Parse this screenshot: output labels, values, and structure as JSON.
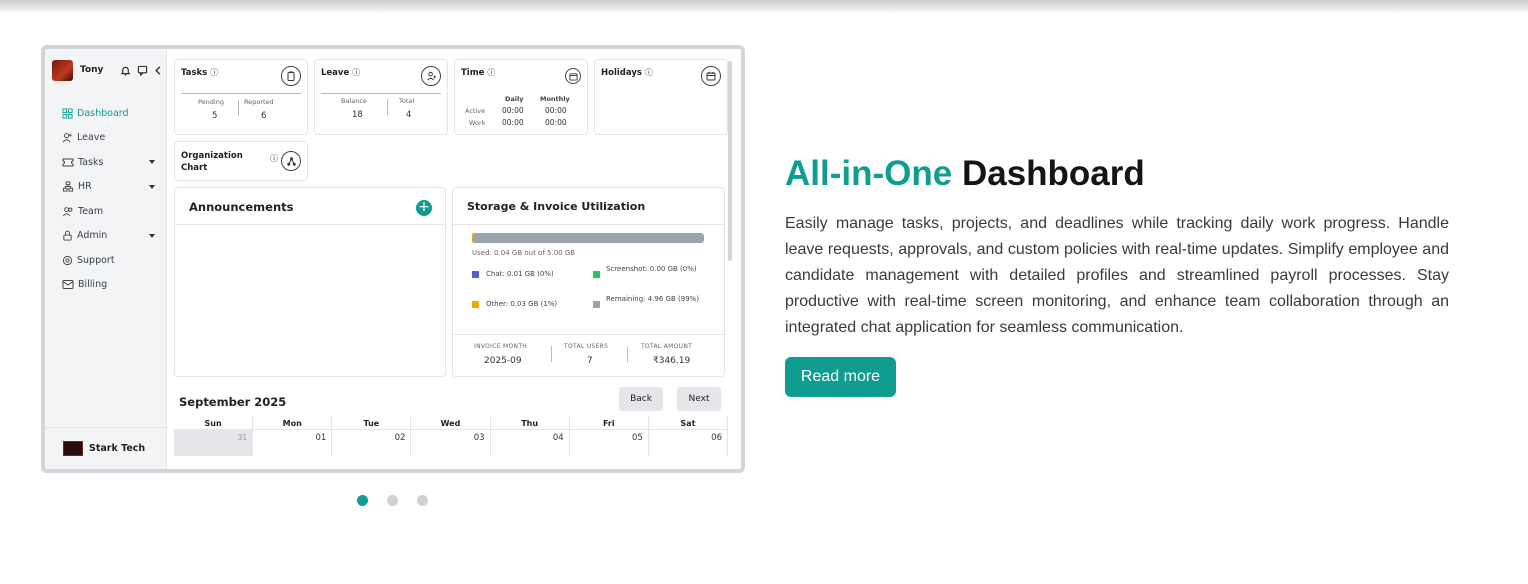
{
  "screenshot": {
    "user": "Tony",
    "nav": [
      {
        "label": "Dashboard",
        "icon": "grid-icon",
        "active": true,
        "caret": false
      },
      {
        "label": "Leave",
        "icon": "user-plus-icon",
        "active": false,
        "caret": false
      },
      {
        "label": "Tasks",
        "icon": "ticket-icon",
        "active": false,
        "caret": true
      },
      {
        "label": "HR",
        "icon": "hierarchy-icon",
        "active": false,
        "caret": true
      },
      {
        "label": "Team",
        "icon": "users-icon",
        "active": false,
        "caret": false
      },
      {
        "label": "Admin",
        "icon": "lock-icon",
        "active": false,
        "caret": true
      },
      {
        "label": "Support",
        "icon": "headset-icon",
        "active": false,
        "caret": false
      },
      {
        "label": "Billing",
        "icon": "mail-icon",
        "active": false,
        "caret": false
      }
    ],
    "org_name": "Stark Tech",
    "tasks": {
      "title": "Tasks",
      "pending_label": "Pending",
      "pending": "5",
      "reported_label": "Reported",
      "reported": "6"
    },
    "leave": {
      "title": "Leave",
      "balance_label": "Balance",
      "balance": "18",
      "total_label": "Total",
      "total": "4"
    },
    "time": {
      "title": "Time",
      "daily_label": "Daily",
      "monthly_label": "Monthly",
      "active_label": "Active",
      "work_label": "Work",
      "active_daily": "00:00",
      "active_monthly": "00:00",
      "work_daily": "00:00",
      "work_monthly": "00:00"
    },
    "holidays": {
      "title": "Holidays"
    },
    "org_chart": {
      "title_line1": "Organization",
      "title_line2": "Chart"
    },
    "announcements": {
      "title": "Announcements"
    },
    "storage": {
      "title": "Storage & Invoice Utilization",
      "used_fraction": 0.008,
      "used_text": "Used: 0.04 GB out of 5.00 GB",
      "legend": [
        {
          "label": "Chat: 0.01 GB (0%)",
          "color": "#5b5bd6"
        },
        {
          "label": "Screenshot: 0.00 GB (0%)",
          "color": "#22c55e"
        },
        {
          "label": "Other: 0.03 GB (1%)",
          "color": "#f0a800"
        },
        {
          "label": "Remaining: 4.96 GB (99%)",
          "color": "#9ca3ad"
        }
      ],
      "invoice_month_label": "INVOICE MONTH",
      "invoice_month": "2025-09",
      "total_users_label": "TOTAL USERS",
      "total_users": "7",
      "total_amount_label": "TOTAL AMOUNT",
      "total_amount": "₹346.19"
    },
    "calendar": {
      "title": "September 2025",
      "back_label": "Back",
      "next_label": "Next",
      "days_of_week": [
        "Sun",
        "Mon",
        "Tue",
        "Wed",
        "Thu",
        "Fri",
        "Sat"
      ],
      "dates": [
        "31",
        "01",
        "02",
        "03",
        "04",
        "05",
        "06"
      ]
    }
  },
  "carousel": {
    "dot_count": 3,
    "active_index": 0
  },
  "feature": {
    "title_accent": "All-in-One",
    "title_rest": "Dashboard",
    "description": "Easily manage tasks, projects, and deadlines while tracking daily work progress. Handle leave requests, approvals, and custom policies with real-time updates. Simplify employee and candidate management with detailed profiles and streamlined payroll processes. Stay productive with real-time screen monitoring, and enhance team collaboration through an integrated chat application for seamless communication.",
    "button_label": "Read more"
  },
  "colors": {
    "accent": "#0e9d8f",
    "text": "#151515"
  }
}
